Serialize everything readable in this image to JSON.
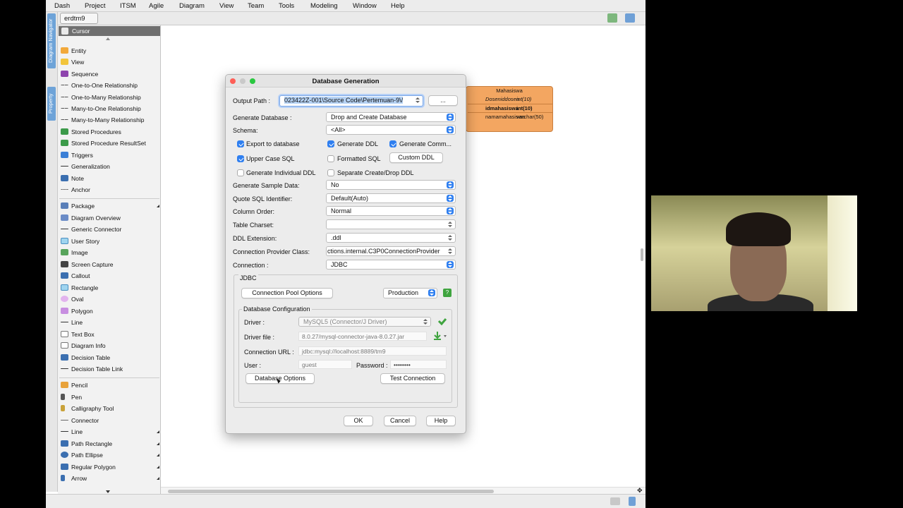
{
  "menu": [
    "Dash",
    "Project",
    "ITSM",
    "Agile",
    "Diagram",
    "View",
    "Team",
    "Tools",
    "Modeling",
    "Window",
    "Help"
  ],
  "diagram_tab": "erdtm9",
  "side_tabs": {
    "navigator": "Diagram Navigator",
    "property": "Property"
  },
  "palette": {
    "cursor": "Cursor",
    "items": [
      "Entity",
      "View",
      "Sequence",
      "One-to-One Relationship",
      "One-to-Many Relationship",
      "Many-to-One Relationship",
      "Many-to-Many Relationship",
      "Stored Procedures",
      "Stored Procedure ResultSet",
      "Triggers",
      "Generalization",
      "Note",
      "Anchor"
    ],
    "items2": [
      "Package",
      "Diagram Overview",
      "Generic Connector",
      "User Story",
      "Image",
      "Screen Capture",
      "Callout",
      "Rectangle",
      "Oval",
      "Polygon",
      "Line",
      "Text Box",
      "Diagram Info",
      "Decision Table",
      "Decision Table Link"
    ],
    "items3": [
      "Pencil",
      "Pen",
      "Calligraphy Tool",
      "Connector",
      "Line",
      "Path Rectangle",
      "Path Ellipse",
      "Regular Polygon",
      "Arrow"
    ]
  },
  "entity": {
    "title": "Mahasiswa",
    "rows": [
      {
        "name": "Doseniddosen",
        "type": "int(10)"
      },
      {
        "name": "idmahasiswa",
        "type": "int(10)"
      },
      {
        "name": "namamahasiswa",
        "type": "varchar(50)"
      }
    ]
  },
  "dialog": {
    "title": "Database Generation",
    "output_path_label": "Output Path :",
    "output_path_value": "023422Z-001\\Source Code\\Pertemuan-9\\/",
    "browse_label": "...",
    "generate_database_label": "Generate Database :",
    "generate_database_value": "Drop and Create Database",
    "schema_label": "Schema:",
    "schema_value": "<All>",
    "export_to_database": "Export to database",
    "generate_ddl": "Generate DDL",
    "generate_comment": "Generate Comm...",
    "upper_case_sql": "Upper Case SQL",
    "formatted_sql": "Formatted SQL",
    "custom_ddl": "Custom DDL",
    "generate_individual_ddl": "Generate Individual DDL",
    "separate_create_drop": "Separate Create/Drop DDL",
    "sample_data_label": "Generate Sample Data:",
    "sample_data_value": "No",
    "quote_label": "Quote SQL Identifier:",
    "quote_value": "Default(Auto)",
    "column_order_label": "Column Order:",
    "column_order_value": "Normal",
    "table_charset_label": "Table Charset:",
    "table_charset_value": "",
    "ddl_extension_label": "DDL Extension:",
    "ddl_extension_value": ".ddl",
    "provider_label": "Connection Provider Class:",
    "provider_value": "ctions.internal.C3P0ConnectionProvider",
    "connection_label": "Connection :",
    "connection_value": "JDBC",
    "jdbc_group": "JDBC",
    "pool_options": "Connection Pool Options",
    "environment": "Production",
    "db_config_group": "Database Configuration",
    "driver_label": "Driver :",
    "driver_value": "MySQL5 (Connector/J Driver)",
    "driver_file_label": "Driver file :",
    "driver_file_value": "8.0.27/mysql-connector-java-8.0.27.jar",
    "url_label": "Connection URL :",
    "url_value": "jdbc:mysql://localhost:8889/tm9",
    "user_label": "User :",
    "user_value": "guest",
    "password_label": "Password :",
    "password_value": "••••••••",
    "database_options": "Database Options",
    "test_connection": "Test Connection",
    "ok": "OK",
    "cancel": "Cancel",
    "help": "Help"
  },
  "colors": {
    "accent": "#2f7ff0",
    "entity_fill": "#f3a661",
    "selection": "#b6d3f5"
  }
}
